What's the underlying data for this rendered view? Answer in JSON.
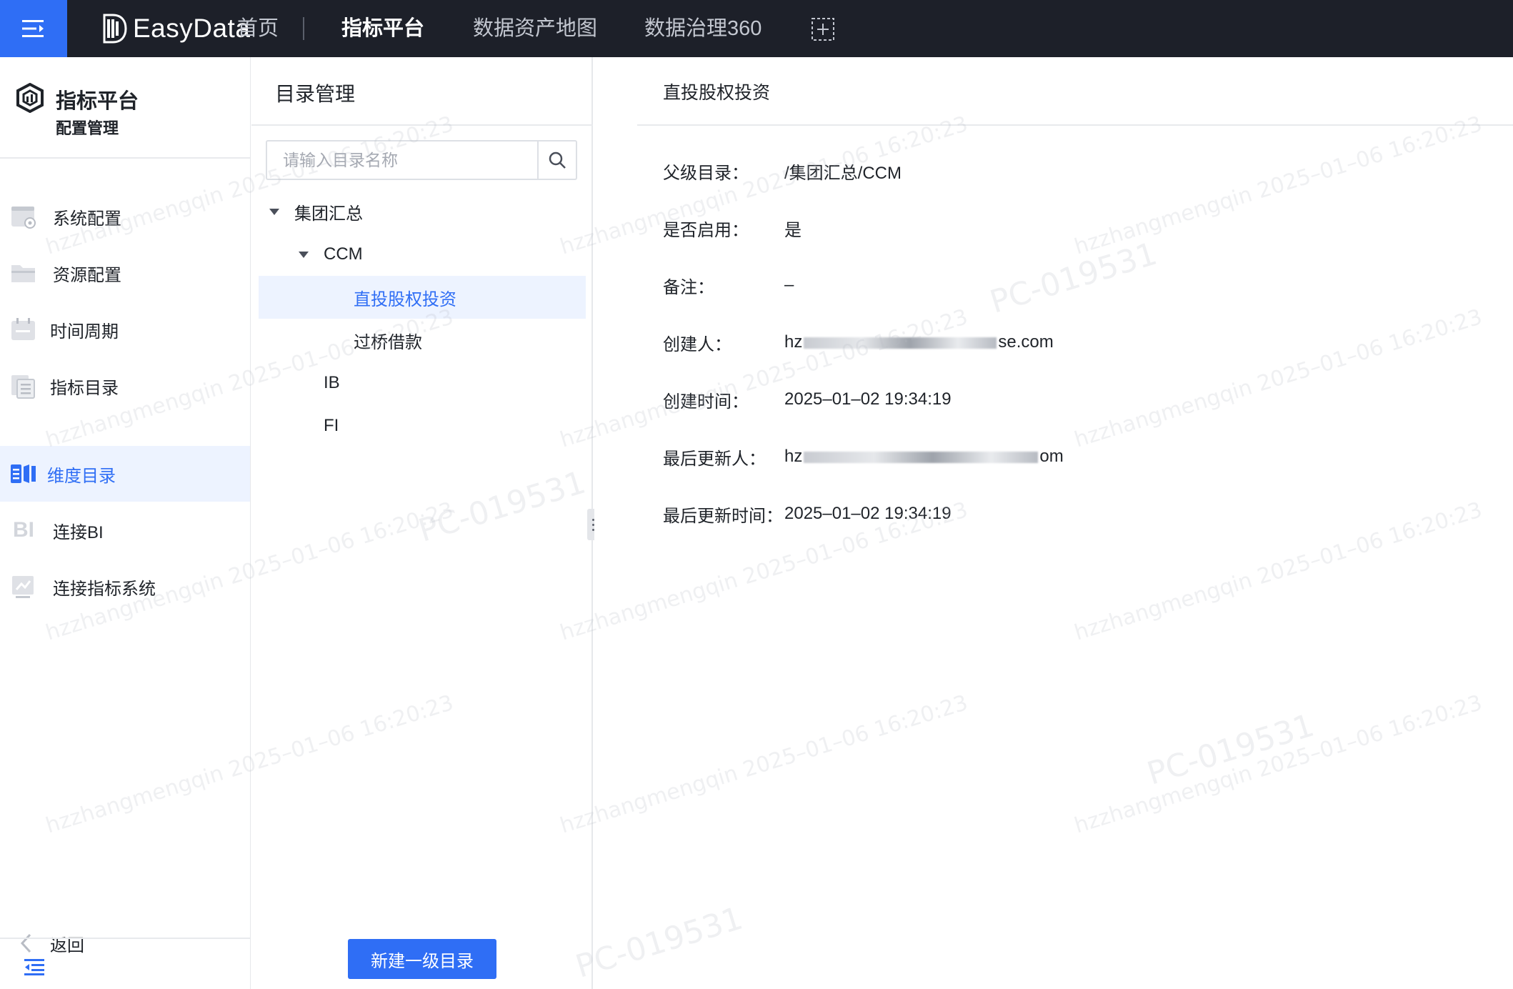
{
  "topbar": {
    "logo_text": "EasyData",
    "nav": [
      {
        "label": "首页",
        "active": false
      },
      {
        "label": "指标平台",
        "active": true
      },
      {
        "label": "数据资产地图",
        "active": false
      },
      {
        "label": "数据治理360",
        "active": false
      }
    ],
    "add_tab_icon": "add-tab-icon",
    "colors": {
      "bar": "#1d2029",
      "menu": "#2f6ef5"
    }
  },
  "sidebar": {
    "title": "指标平台",
    "subtitle": "配置管理",
    "items": [
      {
        "label": "系统配置",
        "icon": "system-config-icon",
        "active": false
      },
      {
        "label": "资源配置",
        "icon": "folder-icon",
        "active": false
      },
      {
        "label": "时间周期",
        "icon": "calendar-icon",
        "active": false
      },
      {
        "label": "指标目录",
        "icon": "metric-catalog-icon",
        "active": false
      },
      {
        "label": "维度目录",
        "icon": "dimension-catalog-icon",
        "active": true
      },
      {
        "label": "连接BI",
        "icon": "bi-icon",
        "active": false
      },
      {
        "label": "连接指标系统",
        "icon": "connect-metric-system-icon",
        "active": false
      }
    ],
    "back_label": "返回"
  },
  "directory": {
    "title": "目录管理",
    "search_placeholder": "请输入目录名称",
    "tree": [
      {
        "label": "集团汇总",
        "level": 0,
        "expanded": true
      },
      {
        "label": "CCM",
        "level": 1,
        "expanded": true
      },
      {
        "label": "直投股权投资",
        "level": 2,
        "selected": true
      },
      {
        "label": "过桥借款",
        "level": 2
      },
      {
        "label": "IB",
        "level": 1
      },
      {
        "label": "FI",
        "level": 1
      }
    ],
    "new_button": "新建一级目录"
  },
  "detail": {
    "title": "直投股权投资",
    "fields": [
      {
        "key": "父级目录：",
        "value": "/集团汇总/CCM"
      },
      {
        "key": "是否启用：",
        "value": "是"
      },
      {
        "key": "备注：",
        "value": "–"
      },
      {
        "key": "创建人：",
        "value_prefix": "hz",
        "value_suffix": "se.com"
      },
      {
        "key": "创建时间：",
        "value": "2025–01–02 19:34:19"
      },
      {
        "key": "最后更新人：",
        "value_prefix": "hz",
        "value_suffix": "om"
      },
      {
        "key": "最后更新时间：",
        "value": "2025–01–02 19:34:19"
      }
    ]
  },
  "watermark": {
    "text": "hzzhangmengqin 2025–01–06 16:20:23",
    "code": "PC-019531"
  }
}
